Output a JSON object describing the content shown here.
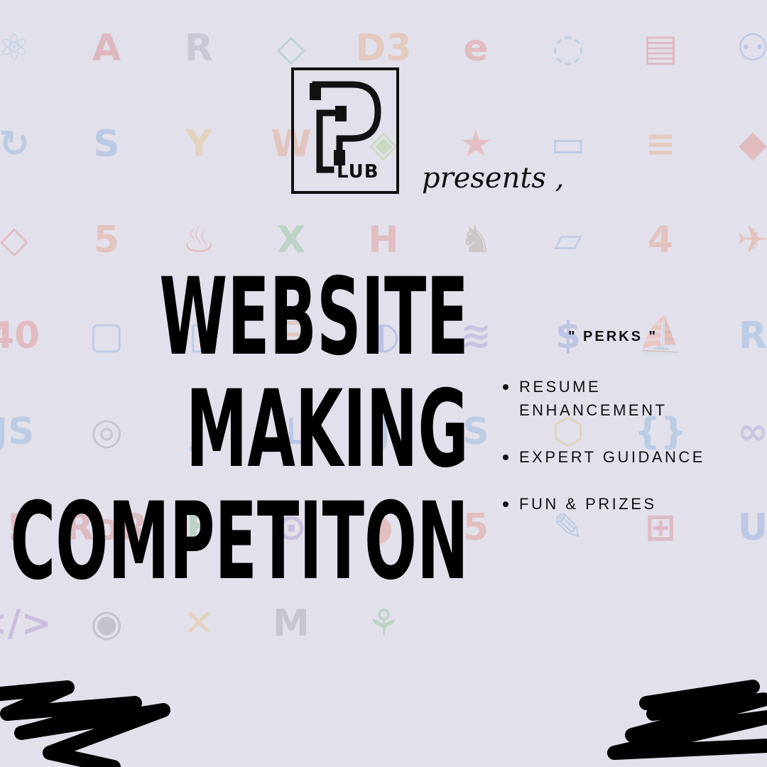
{
  "logo": {
    "text": "LUB"
  },
  "presents": "presents ,",
  "title": {
    "lines": [
      "WEBSITE",
      "MAKING",
      "COMPETITON"
    ]
  },
  "perks": {
    "heading": "\" PERKS \"",
    "items": [
      "RESUME ENHANCEMENT",
      "EXPERT GUIDANCE",
      "FUN & PRIZES"
    ]
  },
  "colors": {
    "background": "#e2e0ea",
    "text": "#111111"
  },
  "background_icons": [
    {
      "glyph": "⚛",
      "color": "#4aa8d8",
      "name": "react-icon"
    },
    {
      "glyph": "A",
      "color": "#d03030",
      "name": "angular-icon"
    },
    {
      "glyph": "R",
      "color": "#6d7a8a",
      "name": "r-lang-icon"
    },
    {
      "glyph": "◇",
      "color": "#3aa88a",
      "name": "elm-icon"
    },
    {
      "glyph": "D3",
      "color": "#e8802a",
      "name": "d3-icon"
    },
    {
      "glyph": "e",
      "color": "#e03a2a",
      "name": "ember-icon"
    },
    {
      "glyph": "◌",
      "color": "#3a9ad8",
      "name": "sync-icon"
    },
    {
      "glyph": "▤",
      "color": "#d03a3a",
      "name": "database-icon"
    },
    {
      "glyph": "⚇",
      "color": "#3a6ad0",
      "name": "postgres-icon"
    },
    {
      "glyph": "↻",
      "color": "#3a8ac8",
      "name": "refresh-icon"
    },
    {
      "glyph": "S",
      "color": "#3a7ad8",
      "name": "sass-icon"
    },
    {
      "glyph": "Y",
      "color": "#e8a82a",
      "name": "yarn-icon"
    },
    {
      "glyph": "W",
      "color": "#e86a2a",
      "name": "webpack-icon"
    },
    {
      "glyph": "◈",
      "color": "#7ac83a",
      "name": "node-icon"
    },
    {
      "glyph": "★",
      "color": "#e8503a",
      "name": "star-icon"
    },
    {
      "glyph": "▭",
      "color": "#3a8ad8",
      "name": "chat-icon"
    },
    {
      "glyph": "≡",
      "color": "#e8882a",
      "name": "stackoverflow-icon"
    },
    {
      "glyph": "◆",
      "color": "#e0402a",
      "name": "git-icon"
    },
    {
      "glyph": "◇",
      "color": "#e03a4a",
      "name": "ruby-icon"
    },
    {
      "glyph": "5",
      "color": "#e8602a",
      "name": "html5-icon"
    },
    {
      "glyph": "♨",
      "color": "#e8502a",
      "name": "firebase-icon"
    },
    {
      "glyph": "X",
      "color": "#3aa84a",
      "name": "excel-icon"
    },
    {
      "glyph": "H",
      "color": "#e04a3a",
      "name": "hackerrank-icon"
    },
    {
      "glyph": "♞",
      "color": "#8a6a4a",
      "name": "perl-icon"
    },
    {
      "glyph": "▱",
      "color": "#5a8ad8",
      "name": "tablet-icon"
    },
    {
      "glyph": "4",
      "color": "#e8602a",
      "name": "four-icon"
    },
    {
      "glyph": "✈",
      "color": "#e8602a",
      "name": "swift-icon"
    },
    {
      "glyph": "40",
      "color": "#e03a3a",
      "name": "error-404-icon"
    },
    {
      "glyph": "▢",
      "color": "#3a8ad8",
      "name": "device-icon"
    },
    {
      "glyph": "▯",
      "color": "#3a8ad8",
      "name": "tablet2-icon"
    },
    {
      "glyph": "☰",
      "color": "#e0703a",
      "name": "grid-icon"
    },
    {
      "glyph": "◐",
      "color": "#3a5ad0",
      "name": "mysql-icon"
    },
    {
      "glyph": "≋",
      "color": "#7a5ac8",
      "name": "php-icon"
    },
    {
      "glyph": "$",
      "color": "#3a6ad0",
      "name": "dollar-icon"
    },
    {
      "glyph": "⛵",
      "color": "#e8a82a",
      "name": "sail-icon"
    },
    {
      "glyph": "R",
      "color": "#3a8ad8",
      "name": "r-icon"
    },
    {
      "glyph": "JS",
      "color": "#3a8ad8",
      "name": "js-icon"
    },
    {
      "glyph": "◎",
      "color": "#6a6a6a",
      "name": "jquery-icon"
    },
    {
      "glyph": "J",
      "color": "#3a8ad8",
      "name": "j-icon"
    },
    {
      "glyph": "⊥",
      "color": "#3a6ad0",
      "name": "t-icon"
    },
    {
      "glyph": "J",
      "color": "#3a8ad8",
      "name": "j2-icon"
    },
    {
      "glyph": "S",
      "color": "#3a8ad8",
      "name": "s-icon"
    },
    {
      "glyph": "⬡",
      "color": "#e8a82a",
      "name": "sass-hex-icon"
    },
    {
      "glyph": "{}",
      "color": "#3a8ad8",
      "name": "braces-icon"
    },
    {
      "glyph": "∞",
      "color": "#7a6ac8",
      "name": "infinity-icon"
    },
    {
      "glyph": "!",
      "color": "#e03a3a",
      "name": "exclaim-icon"
    },
    {
      "glyph": "RoR",
      "color": "#d03a3a",
      "name": "rails-icon"
    },
    {
      "glyph": "F",
      "color": "#3aa84a",
      "name": "feathers-icon"
    },
    {
      "glyph": "⊙",
      "color": "#7a4ab8",
      "name": "onion-icon"
    },
    {
      "glyph": "◗",
      "color": "#e8502a",
      "name": "bird-icon"
    },
    {
      "glyph": "5",
      "color": "#e04a2a",
      "name": "html5-shield-icon"
    },
    {
      "glyph": "✎",
      "color": "#3a8ad8",
      "name": "feather-icon"
    },
    {
      "glyph": "⊞",
      "color": "#d03a3a",
      "name": "rail-icon"
    },
    {
      "glyph": "U",
      "color": "#3a7ad8",
      "name": "u-icon"
    },
    {
      "glyph": "</>",
      "color": "#7a4ab8",
      "name": "code-icon"
    },
    {
      "glyph": "◉",
      "color": "#5a5a6a",
      "name": "eclipse-icon"
    },
    {
      "glyph": "✕",
      "color": "#e8a82a",
      "name": "cross-icon"
    },
    {
      "glyph": "M",
      "color": "#6a6a6a",
      "name": "medium-icon"
    },
    {
      "glyph": "⚘",
      "color": "#3aa84a",
      "name": "mongodb-icon"
    }
  ]
}
